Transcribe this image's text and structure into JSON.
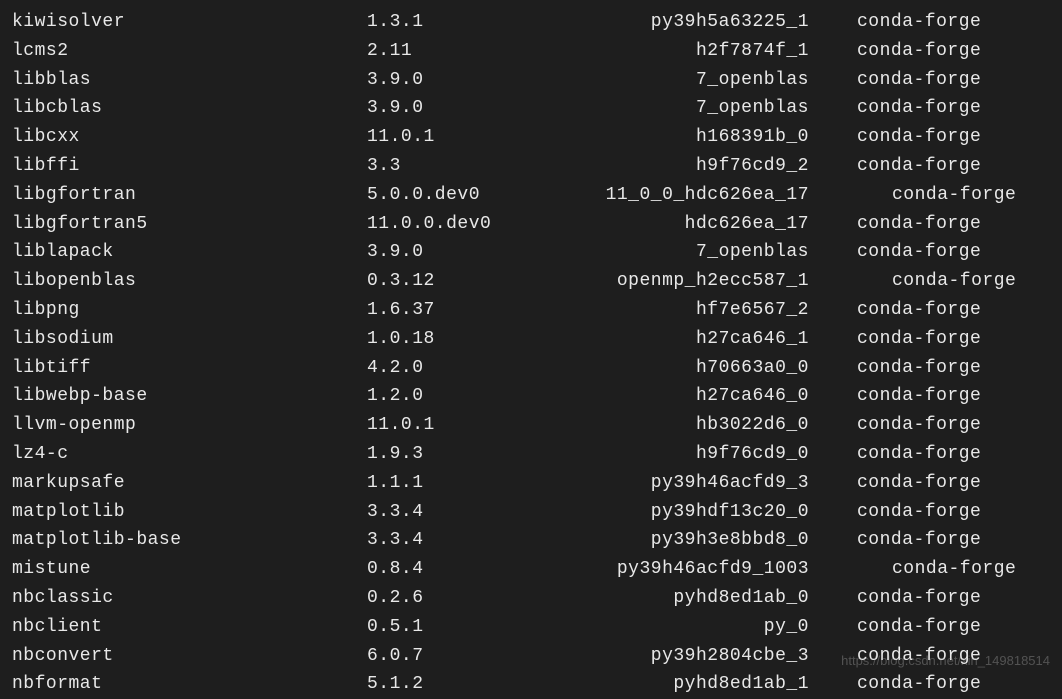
{
  "packages": [
    {
      "name": "kiwisolver",
      "version": "1.3.1",
      "build": "py39h5a63225_1",
      "channel": "conda-forge",
      "indent": false
    },
    {
      "name": "lcms2",
      "version": "2.11",
      "build": "h2f7874f_1",
      "channel": "conda-forge",
      "indent": false
    },
    {
      "name": "libblas",
      "version": "3.9.0",
      "build": "7_openblas",
      "channel": "conda-forge",
      "indent": false
    },
    {
      "name": "libcblas",
      "version": "3.9.0",
      "build": "7_openblas",
      "channel": "conda-forge",
      "indent": false
    },
    {
      "name": "libcxx",
      "version": "11.0.1",
      "build": "h168391b_0",
      "channel": "conda-forge",
      "indent": false
    },
    {
      "name": "libffi",
      "version": "3.3",
      "build": "h9f76cd9_2",
      "channel": "conda-forge",
      "indent": false
    },
    {
      "name": "libgfortran",
      "version": "5.0.0.dev0",
      "build": "11_0_0_hdc626ea_17",
      "channel": "conda-forge",
      "indent": true
    },
    {
      "name": "libgfortran5",
      "version": "11.0.0.dev0",
      "build": "hdc626ea_17",
      "channel": "conda-forge",
      "indent": false
    },
    {
      "name": "liblapack",
      "version": "3.9.0",
      "build": "7_openblas",
      "channel": "conda-forge",
      "indent": false
    },
    {
      "name": "libopenblas",
      "version": "0.3.12",
      "build": "openmp_h2ecc587_1",
      "channel": "conda-forge",
      "indent": true
    },
    {
      "name": "libpng",
      "version": "1.6.37",
      "build": "hf7e6567_2",
      "channel": "conda-forge",
      "indent": false
    },
    {
      "name": "libsodium",
      "version": "1.0.18",
      "build": "h27ca646_1",
      "channel": "conda-forge",
      "indent": false
    },
    {
      "name": "libtiff",
      "version": "4.2.0",
      "build": "h70663a0_0",
      "channel": "conda-forge",
      "indent": false
    },
    {
      "name": "libwebp-base",
      "version": "1.2.0",
      "build": "h27ca646_0",
      "channel": "conda-forge",
      "indent": false
    },
    {
      "name": "llvm-openmp",
      "version": "11.0.1",
      "build": "hb3022d6_0",
      "channel": "conda-forge",
      "indent": false
    },
    {
      "name": "lz4-c",
      "version": "1.9.3",
      "build": "h9f76cd9_0",
      "channel": "conda-forge",
      "indent": false
    },
    {
      "name": "markupsafe",
      "version": "1.1.1",
      "build": "py39h46acfd9_3",
      "channel": "conda-forge",
      "indent": false
    },
    {
      "name": "matplotlib",
      "version": "3.3.4",
      "build": "py39hdf13c20_0",
      "channel": "conda-forge",
      "indent": false
    },
    {
      "name": "matplotlib-base",
      "version": "3.3.4",
      "build": "py39h3e8bbd8_0",
      "channel": "conda-forge",
      "indent": false
    },
    {
      "name": "mistune",
      "version": "0.8.4",
      "build": "py39h46acfd9_1003",
      "channel": "conda-forge",
      "indent": true
    },
    {
      "name": "nbclassic",
      "version": "0.2.6",
      "build": "pyhd8ed1ab_0",
      "channel": "conda-forge",
      "indent": false
    },
    {
      "name": "nbclient",
      "version": "0.5.1",
      "build": "py_0",
      "channel": "conda-forge",
      "indent": false
    },
    {
      "name": "nbconvert",
      "version": "6.0.7",
      "build": "py39h2804cbe_3",
      "channel": "conda-forge",
      "indent": false
    },
    {
      "name": "nbformat",
      "version": "5.1.2",
      "build": "pyhd8ed1ab_1",
      "channel": "conda-forge",
      "indent": false
    }
  ],
  "watermark": "https://blog.csdn.net/xin_149818514"
}
